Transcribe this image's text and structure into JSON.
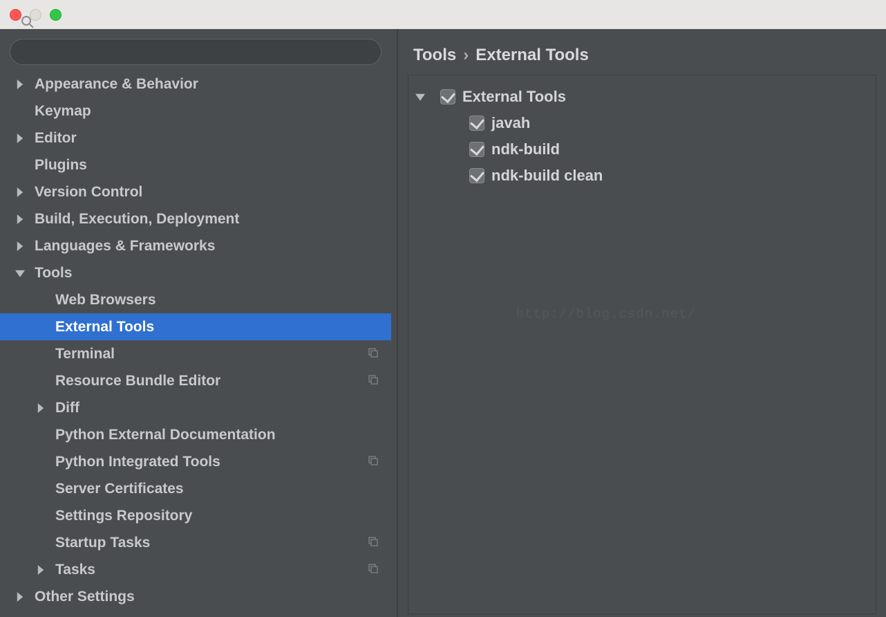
{
  "breadcrumb": {
    "root": "Tools",
    "sep": "›",
    "current": "External Tools"
  },
  "watermark": "http://blog.csdn.net/",
  "sidebar": {
    "items": [
      {
        "label": "Appearance & Behavior",
        "arrow": "right",
        "indent": 0,
        "copy": false
      },
      {
        "label": "Keymap",
        "arrow": "",
        "indent": 0,
        "copy": false
      },
      {
        "label": "Editor",
        "arrow": "right",
        "indent": 0,
        "copy": false
      },
      {
        "label": "Plugins",
        "arrow": "",
        "indent": 0,
        "copy": false
      },
      {
        "label": "Version Control",
        "arrow": "right",
        "indent": 0,
        "copy": false
      },
      {
        "label": "Build, Execution, Deployment",
        "arrow": "right",
        "indent": 0,
        "copy": false
      },
      {
        "label": "Languages & Frameworks",
        "arrow": "right",
        "indent": 0,
        "copy": false
      },
      {
        "label": "Tools",
        "arrow": "down",
        "indent": 0,
        "copy": false
      },
      {
        "label": "Web Browsers",
        "arrow": "",
        "indent": 1,
        "copy": false
      },
      {
        "label": "External Tools",
        "arrow": "",
        "indent": 1,
        "copy": false,
        "selected": true
      },
      {
        "label": "Terminal",
        "arrow": "",
        "indent": 1,
        "copy": true
      },
      {
        "label": "Resource Bundle Editor",
        "arrow": "",
        "indent": 1,
        "copy": true
      },
      {
        "label": "Diff",
        "arrow": "right",
        "indent": 1,
        "copy": false
      },
      {
        "label": "Python External Documentation",
        "arrow": "",
        "indent": 1,
        "copy": false
      },
      {
        "label": "Python Integrated Tools",
        "arrow": "",
        "indent": 1,
        "copy": true
      },
      {
        "label": "Server Certificates",
        "arrow": "",
        "indent": 1,
        "copy": false
      },
      {
        "label": "Settings Repository",
        "arrow": "",
        "indent": 1,
        "copy": false
      },
      {
        "label": "Startup Tasks",
        "arrow": "",
        "indent": 1,
        "copy": true
      },
      {
        "label": "Tasks",
        "arrow": "right",
        "indent": 1,
        "copy": true
      },
      {
        "label": "Other Settings",
        "arrow": "right",
        "indent": 0,
        "copy": false
      }
    ]
  },
  "ext_tools": {
    "group": "External Tools",
    "items": [
      {
        "label": "javah"
      },
      {
        "label": "ndk-build"
      },
      {
        "label": "ndk-build clean"
      }
    ]
  }
}
